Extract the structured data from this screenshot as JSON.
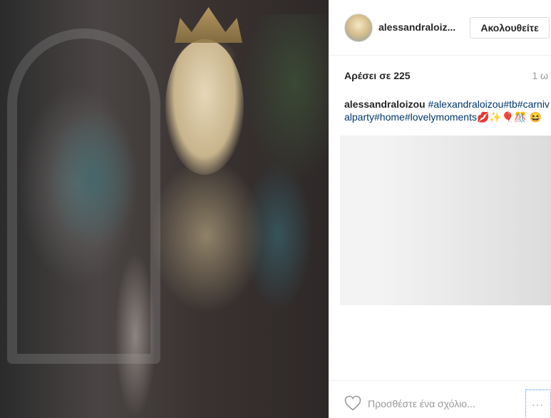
{
  "header": {
    "username": "alessandraloiz...",
    "follow_label": "Ακολουθείτε"
  },
  "post": {
    "likes": "Αρέσει σε 225",
    "time": "1 ω",
    "caption_author": "alessandraloizou",
    "caption_tags": "#alexandraloizou#tb#carnivalparty#home#lovelymoments",
    "caption_emoji": "💋✨🎈🎊 😆"
  },
  "footer": {
    "comment_placeholder": "Προσθέστε ένα σχόλιο...",
    "more_label": "···"
  }
}
